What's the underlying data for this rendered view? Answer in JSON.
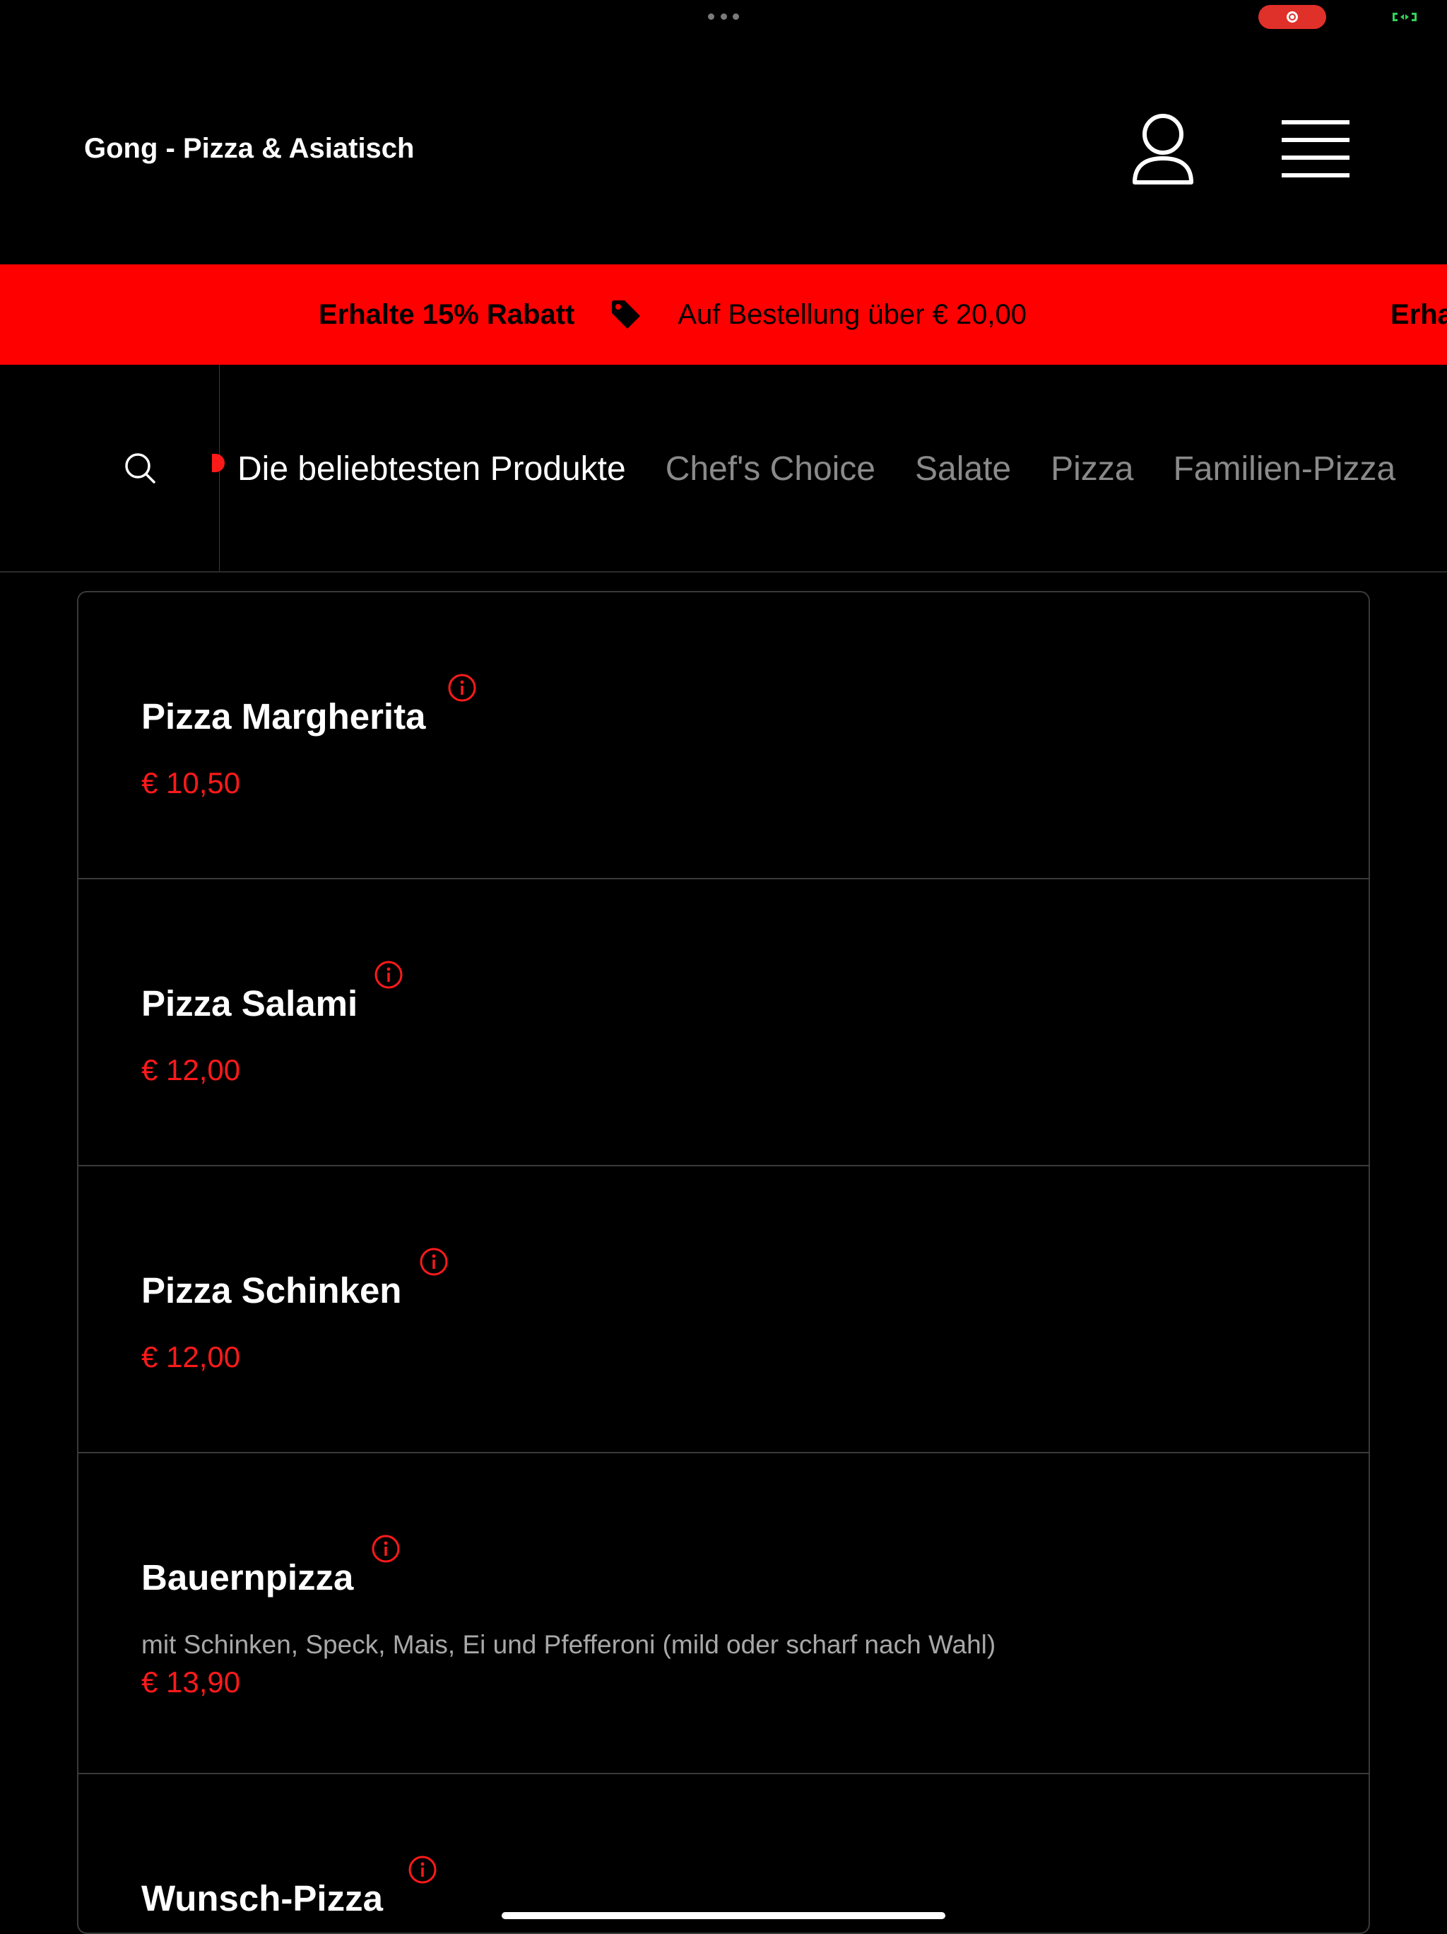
{
  "header": {
    "restaurant_name": "Gong - Pizza & Asiatisch"
  },
  "promo": {
    "bold": "Erhalte 15% Rabatt",
    "text": "Auf Bestellung über € 20,00",
    "repeat": "Erha"
  },
  "categories": [
    {
      "label": "Die beliebtesten Produkte",
      "active": true
    },
    {
      "label": "Chef's Choice",
      "active": false
    },
    {
      "label": "Salate",
      "active": false
    },
    {
      "label": "Pizza",
      "active": false
    },
    {
      "label": "Familien-Pizza",
      "active": false
    }
  ],
  "products": [
    {
      "name": "Pizza Margherita",
      "description": "",
      "price": "€ 10,50"
    },
    {
      "name": "Pizza Salami",
      "description": "",
      "price": "€ 12,00"
    },
    {
      "name": "Pizza Schinken",
      "description": "",
      "price": "€ 12,00"
    },
    {
      "name": "Bauernpizza",
      "description": "mit Schinken, Speck, Mais, Ei und Pfefferoni (mild oder scharf nach Wahl)",
      "price": "€ 13,90"
    },
    {
      "name": "Wunsch-Pizza",
      "description": "",
      "price": ""
    }
  ],
  "colors": {
    "accent": "#ff0000",
    "price": "#ff1a1a",
    "background": "#000000",
    "recording": "#e0302a"
  },
  "icons": {
    "user": "user-icon",
    "menu": "hamburger-menu-icon",
    "search": "search-icon",
    "tag": "price-tag-icon",
    "info": "info-icon"
  }
}
